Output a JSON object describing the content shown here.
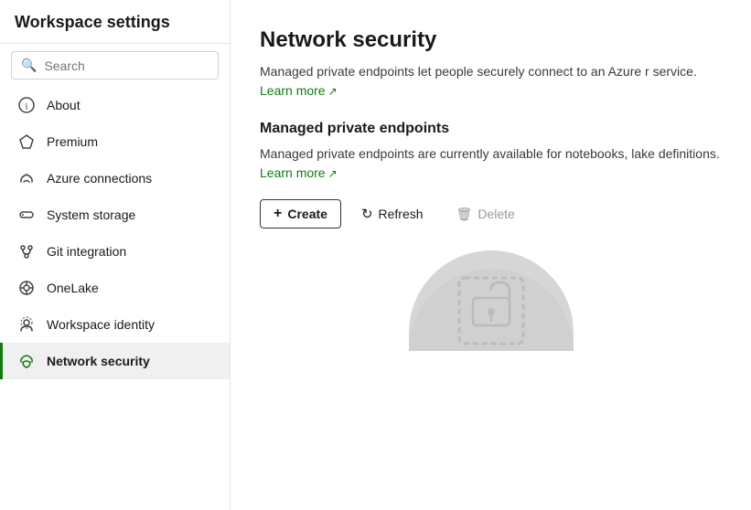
{
  "sidebar": {
    "title": "Workspace settings",
    "search_placeholder": "Search",
    "items": [
      {
        "id": "about",
        "label": "About",
        "icon": "ℹ"
      },
      {
        "id": "premium",
        "label": "Premium",
        "icon": "◇"
      },
      {
        "id": "azure-connections",
        "label": "Azure connections",
        "icon": "☁"
      },
      {
        "id": "system-storage",
        "label": "System storage",
        "icon": "▭"
      },
      {
        "id": "git-integration",
        "label": "Git integration",
        "icon": "◈"
      },
      {
        "id": "onelake",
        "label": "OneLake",
        "icon": "⊕"
      },
      {
        "id": "workspace-identity",
        "label": "Workspace identity",
        "icon": "⊙"
      },
      {
        "id": "network-security",
        "label": "Network security",
        "icon": "☁",
        "active": true
      }
    ]
  },
  "main": {
    "title": "Network security",
    "description": "Managed private endpoints let people securely connect to an Azure r service.",
    "learn_more_1": "Learn more",
    "section_title": "Managed private endpoints",
    "section_description": "Managed private endpoints are currently available for notebooks, lake definitions.",
    "learn_more_2": "Learn more",
    "buttons": {
      "create": "Create",
      "refresh": "Refresh",
      "delete": "Delete"
    }
  },
  "colors": {
    "active_border": "#107c10",
    "link": "#107c10"
  }
}
